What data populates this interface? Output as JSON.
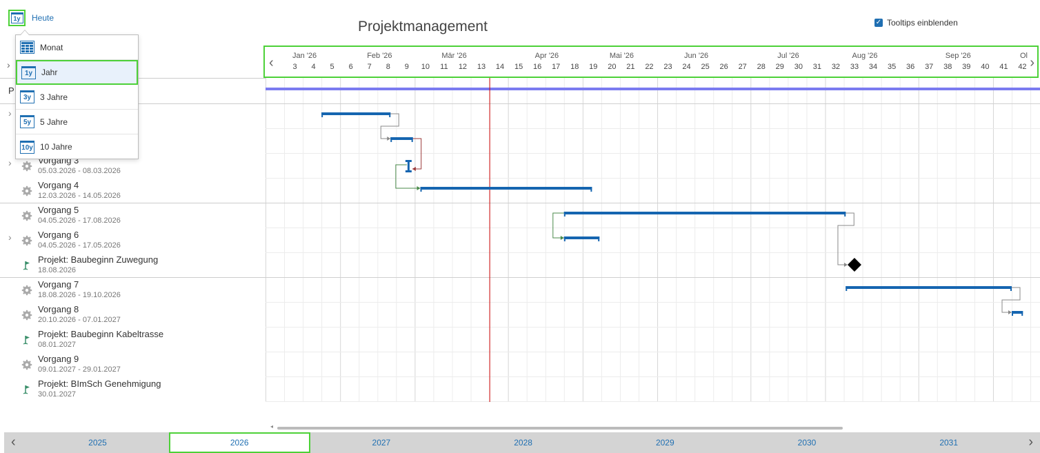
{
  "header": {
    "view_button_icon": "1y",
    "today_label": "Heute",
    "title": "Projektmanagement",
    "tooltips_label": "Tooltips einblenden",
    "tooltips_checked": true
  },
  "view_menu": {
    "items": [
      {
        "icon": "calendar-grid-icon",
        "label": "Monat",
        "selected": false
      },
      {
        "icon": "1y",
        "label": "Jahr",
        "selected": true
      },
      {
        "icon": "3y",
        "label": "3 Jahre",
        "selected": false
      },
      {
        "icon": "5y",
        "label": "5 Jahre",
        "selected": false
      },
      {
        "icon": "10y",
        "label": "10 Jahre",
        "selected": false
      }
    ]
  },
  "task_list": {
    "header_fragment": "P",
    "rows": [
      {
        "name": "",
        "dates": "",
        "icon": "",
        "expandable": true
      },
      {
        "name": "",
        "dates": "",
        "icon": "",
        "expandable": false
      },
      {
        "name": "Vorgang 3",
        "dates": "05.03.2026 - 08.03.2026",
        "icon": "gear-icon",
        "expandable": true
      },
      {
        "name": "Vorgang 4",
        "dates": "12.03.2026 - 14.05.2026",
        "icon": "gear-icon",
        "expandable": false
      },
      {
        "name": "Vorgang 5",
        "dates": "04.05.2026 - 17.08.2026",
        "icon": "gear-icon",
        "expandable": false
      },
      {
        "name": "Vorgang 6",
        "dates": "04.05.2026 - 17.05.2026",
        "icon": "gear-icon",
        "expandable": true
      },
      {
        "name": "Projekt: Baubeginn Zuwegung",
        "dates": "18.08.2026",
        "icon": "flag-icon",
        "expandable": false
      },
      {
        "name": "Vorgang 7",
        "dates": "18.08.2026 - 19.10.2026",
        "icon": "gear-icon",
        "expandable": false
      },
      {
        "name": "Vorgang 8",
        "dates": "20.10.2026 - 07.01.2027",
        "icon": "gear-icon",
        "expandable": false
      },
      {
        "name": "Projekt: Baubeginn Kabeltrasse",
        "dates": "08.01.2027",
        "icon": "flag-icon",
        "expandable": false
      },
      {
        "name": "Vorgang 9",
        "dates": "09.01.2027 - 29.01.2027",
        "icon": "gear-icon",
        "expandable": false
      },
      {
        "name": "Projekt: BImSch Genehmigung",
        "dates": "30.01.2027",
        "icon": "flag-icon",
        "expandable": false
      }
    ]
  },
  "timeline": {
    "months": [
      "Jan '26",
      "Feb '26",
      "Mär '26",
      "Apr '26",
      "Mai '26",
      "Jun '26",
      "Jul '26",
      "Aug '26",
      "Sep '26",
      "Ol"
    ],
    "month_start_weeks": [
      3,
      7,
      11,
      16,
      20,
      24,
      29,
      33,
      38,
      42
    ],
    "weeks": [
      "3",
      "4",
      "5",
      "6",
      "7",
      "8",
      "9",
      "10",
      "11",
      "12",
      "13",
      "14",
      "15",
      "16",
      "17",
      "18",
      "19",
      "20",
      "21",
      "22",
      "23",
      "24",
      "25",
      "26",
      "27",
      "28",
      "29",
      "30",
      "31",
      "32",
      "33",
      "34",
      "35",
      "36",
      "37",
      "38",
      "39",
      "40",
      "41",
      "42"
    ],
    "today_week": 15.0,
    "first_week": 3
  },
  "gantt": {
    "bars": [
      {
        "row": 1,
        "start_week": 6.0,
        "end_week": 9.7,
        "kind": "task"
      },
      {
        "row": 2,
        "start_week": 9.7,
        "end_week": 10.9,
        "kind": "task"
      },
      {
        "row": 3,
        "start_week": 10.5,
        "end_week": 10.5,
        "kind": "short"
      },
      {
        "row": 4,
        "start_week": 11.3,
        "end_week": 20.5,
        "kind": "task"
      },
      {
        "row": 5,
        "start_week": 19.0,
        "end_week": 34.1,
        "kind": "task"
      },
      {
        "row": 6,
        "start_week": 19.0,
        "end_week": 20.9,
        "kind": "task"
      },
      {
        "row": 7,
        "start_week": 34.2,
        "end_week": 34.2,
        "kind": "milestone"
      },
      {
        "row": 8,
        "start_week": 34.1,
        "end_week": 43.0,
        "kind": "task"
      },
      {
        "row": 9,
        "start_week": 43.0,
        "end_week": 43.6,
        "kind": "task"
      }
    ]
  },
  "year_nav": {
    "years": [
      "2025",
      "2026",
      "2027",
      "2028",
      "2029",
      "2030",
      "2031"
    ],
    "selected": "2026"
  },
  "colors": {
    "bar": "#1565b0",
    "summary": "#7b7bf0",
    "today": "#cc0000",
    "highlight": "#4cd137",
    "link": "#1f6fb2"
  }
}
